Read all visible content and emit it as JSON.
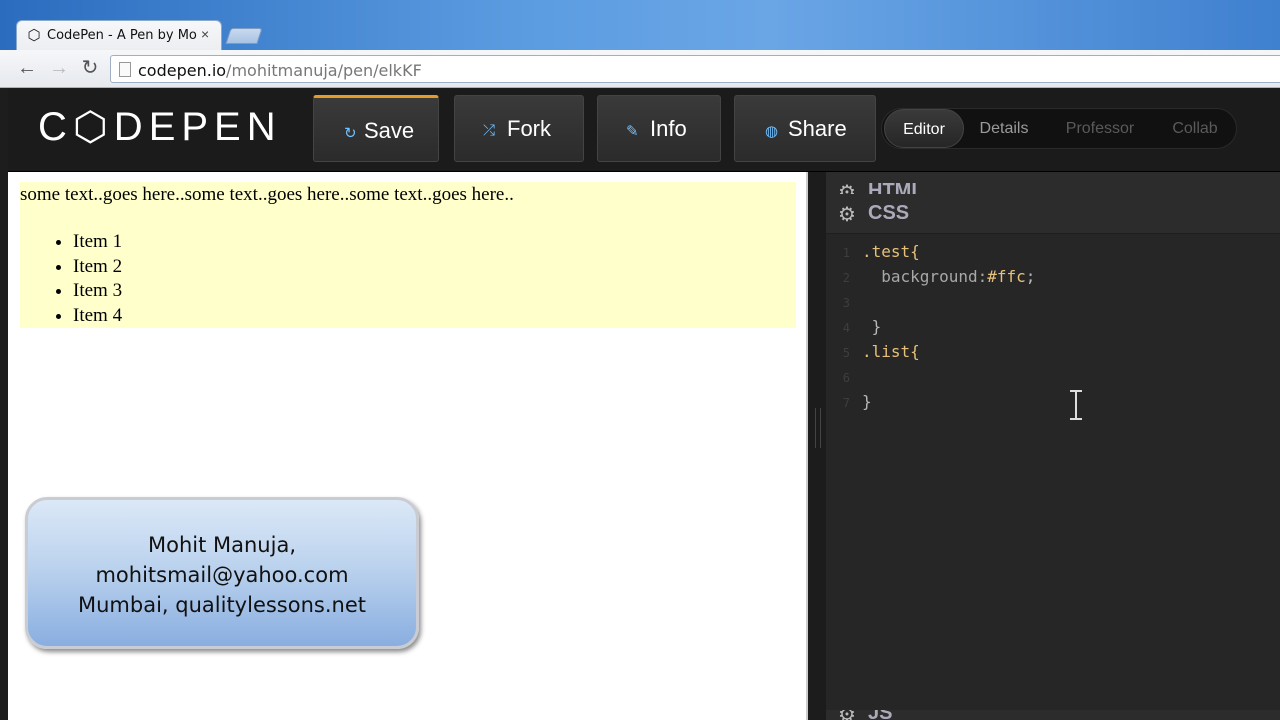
{
  "browser": {
    "tab_title": "CodePen - A Pen by Mohi",
    "tab_close": "×",
    "url_host": "codepen.io",
    "url_path": "/mohitmanuja/pen/elkKF",
    "back": "←",
    "forward": "→",
    "reload": "↻"
  },
  "header": {
    "logo": "C⬡DEPEN",
    "buttons": {
      "save": "Save",
      "fork": "Fork",
      "info": "Info",
      "share": "Share"
    },
    "views": [
      "Editor",
      "Details",
      "Professor",
      "Collab"
    ],
    "active_view": "Editor"
  },
  "result": {
    "text": "some text..goes here..some text..goes here..some text..goes here..",
    "items": [
      "Item 1",
      "Item 2",
      "Item 3",
      "Item 4"
    ],
    "card": {
      "line1": "Mohit Manuja,",
      "line2": "mohitsmail@yahoo.com",
      "line3": "Mumbai, qualitylessons.net"
    }
  },
  "editor": {
    "html_label": "HTML",
    "css_label": "CSS",
    "js_label": "JS",
    "lines": [
      {
        "num": "1",
        "code": ".test{"
      },
      {
        "num": "2",
        "code": "  background:#ffc;"
      },
      {
        "num": "3",
        "code": ""
      },
      {
        "num": "4",
        "code": " }"
      },
      {
        "num": "5",
        "code": ".list{"
      },
      {
        "num": "6",
        "code": ""
      },
      {
        "num": "7",
        "code": "}"
      }
    ]
  },
  "colors": {
    "test_background": "#ffffcc",
    "save_accent": "#e39b2b"
  }
}
